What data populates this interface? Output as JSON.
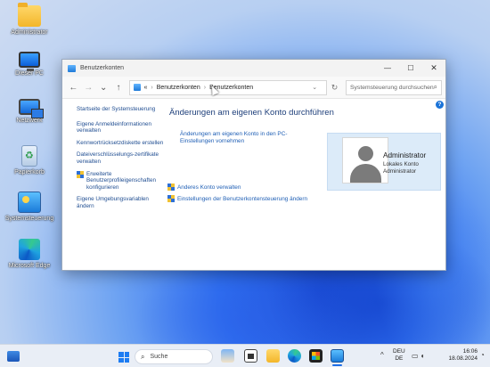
{
  "desktop": {
    "icons": [
      {
        "label": "Administrator",
        "icon": "folder-icon"
      },
      {
        "label": "Dieser PC",
        "icon": "computer-icon"
      },
      {
        "label": "Netzwerk",
        "icon": "network-icon"
      },
      {
        "label": "Papierkorb",
        "icon": "recycle-bin-icon"
      },
      {
        "label": "Systemsteuerung",
        "icon": "control-panel-icon"
      },
      {
        "label": "Microsoft Edge",
        "icon": "edge-icon"
      }
    ]
  },
  "window": {
    "title": "Benutzerkonten",
    "controls": {
      "minimize": "—",
      "maximize": "☐",
      "close": "✕"
    },
    "nav": {
      "back": "←",
      "forward": "→",
      "history": "⌄",
      "up": "↑"
    },
    "address": {
      "chevrons": "«",
      "crumbs": [
        "Benutzerkonten",
        "Benutzerkonten"
      ],
      "separator": "›",
      "dropdown": "⌄"
    },
    "refresh": "↻",
    "search_placeholder": "Systemsteuerung durchsuchen",
    "help": "?",
    "left_pane": {
      "home": "Startseite der Systemsteuerung",
      "items": [
        {
          "label": "Eigene Anmeldeinformationen verwalten",
          "shield": false
        },
        {
          "label": "Kennwortrücksetzdiskette erstellen",
          "shield": false
        },
        {
          "label": "Dateiverschlüsselungs-zertifikate verwalten",
          "shield": false
        },
        {
          "label": "Erweiterte Benutzerprofileigenschaften konfigurieren",
          "shield": true
        },
        {
          "label": "Eigene Umgebungsvariablen ändern",
          "shield": false
        }
      ]
    },
    "main": {
      "heading": "Änderungen am eigenen Konto durchführen",
      "primary_link": "Änderungen am eigenen Konto in den PC-Einstellungen vornehmen",
      "tasks": [
        "Anderes Konto verwalten",
        "Einstellungen der Benutzerkontensteuerung ändern"
      ]
    },
    "account": {
      "name": "Administrator",
      "type": "Lokales Konto",
      "role": "Administrator"
    }
  },
  "taskbar": {
    "search_label": "Suche",
    "tray_chevron": "^",
    "language": [
      "DEU",
      "DE"
    ],
    "time": "16:06",
    "date": "18.08.2024",
    "accent": "#1d6ee8"
  }
}
